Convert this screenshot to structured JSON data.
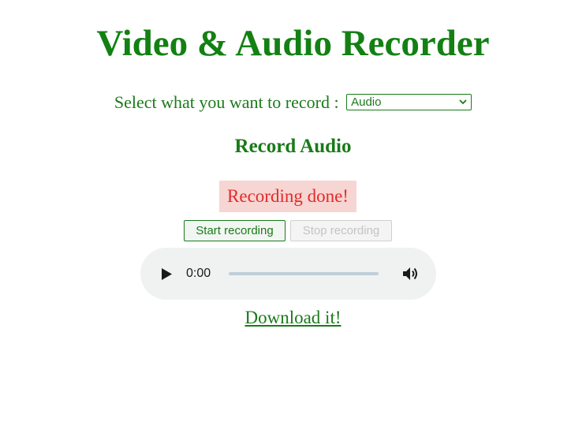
{
  "header": {
    "title": "Video & Audio Recorder"
  },
  "selector": {
    "label": "Select what you want to record :",
    "selected": "Audio"
  },
  "section": {
    "title": "Record Audio"
  },
  "status": {
    "message": "Recording done!"
  },
  "controls": {
    "start_label": "Start recording",
    "stop_label": "Stop recording"
  },
  "player": {
    "time": "0:00",
    "progress": 0
  },
  "download": {
    "label": "Download it!"
  },
  "colors": {
    "text_green": "#1a7a1a",
    "status_red": "#e32a2a",
    "status_bg": "#f6d5d2"
  }
}
